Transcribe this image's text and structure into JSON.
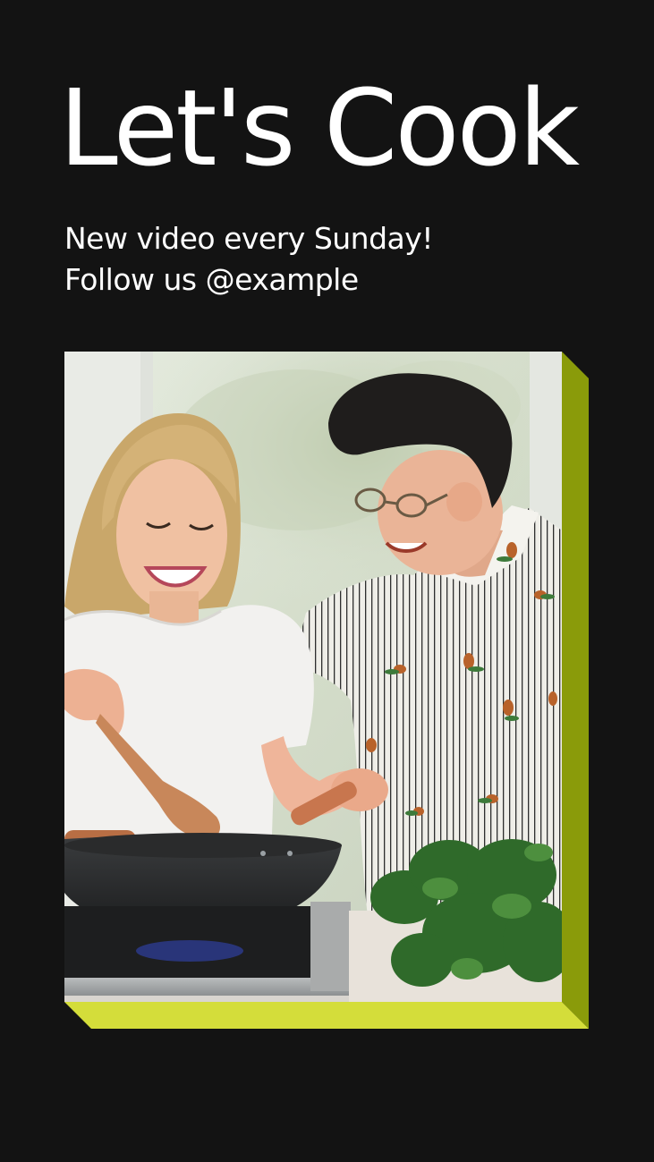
{
  "header": {
    "title": "Let's Cook",
    "subtitle_line1": "New video every Sunday!",
    "subtitle_line2": "Follow us @example"
  },
  "colors": {
    "background": "#131313",
    "accent_side": "#8a9b0a",
    "accent_bottom": "#d4dd3a"
  }
}
